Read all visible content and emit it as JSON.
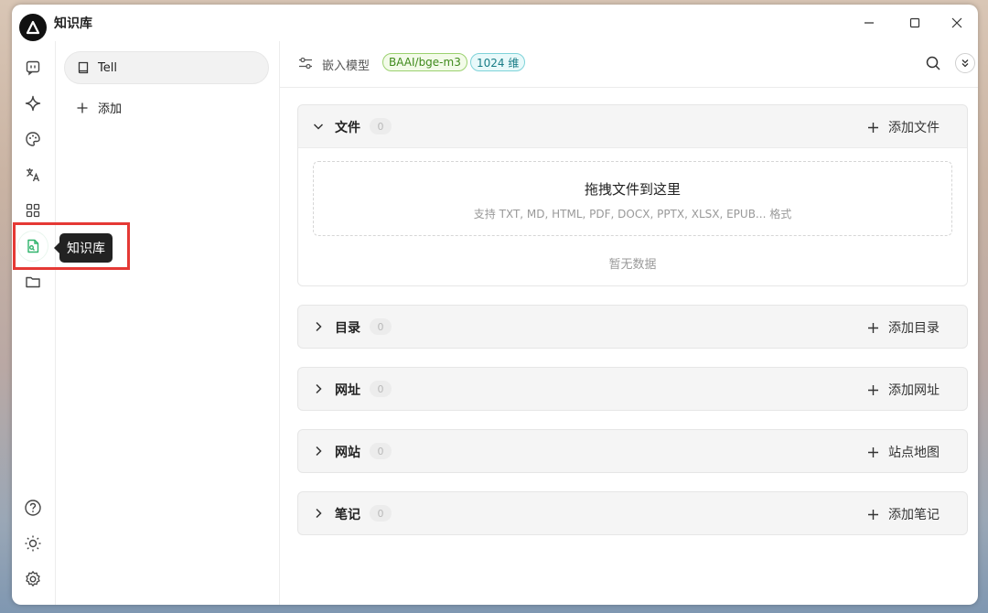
{
  "app": {
    "title": "知识库"
  },
  "tooltip": {
    "text": "知识库"
  },
  "kb_list": {
    "items": [
      {
        "label": "Tell"
      }
    ],
    "add_label": "添加"
  },
  "header": {
    "embed_label": "嵌入模型",
    "model_tag": "BAAI/bge-m3",
    "dim_tag": "1024 维"
  },
  "sections": [
    {
      "title": "文件",
      "count": "0",
      "action": "添加文件",
      "expanded": true,
      "dropzone_title": "拖拽文件到这里",
      "dropzone_sub": "支持 TXT, MD, HTML, PDF, DOCX, PPTX, XLSX, EPUB... 格式",
      "empty_text": "暂无数据"
    },
    {
      "title": "目录",
      "count": "0",
      "action": "添加目录",
      "expanded": false
    },
    {
      "title": "网址",
      "count": "0",
      "action": "添加网址",
      "expanded": false
    },
    {
      "title": "网站",
      "count": "0",
      "action": "站点地图",
      "expanded": false
    },
    {
      "title": "笔记",
      "count": "0",
      "action": "添加笔记",
      "expanded": false
    }
  ],
  "colors": {
    "accent_green": "#2fb36b",
    "highlight_red": "#e53935"
  }
}
